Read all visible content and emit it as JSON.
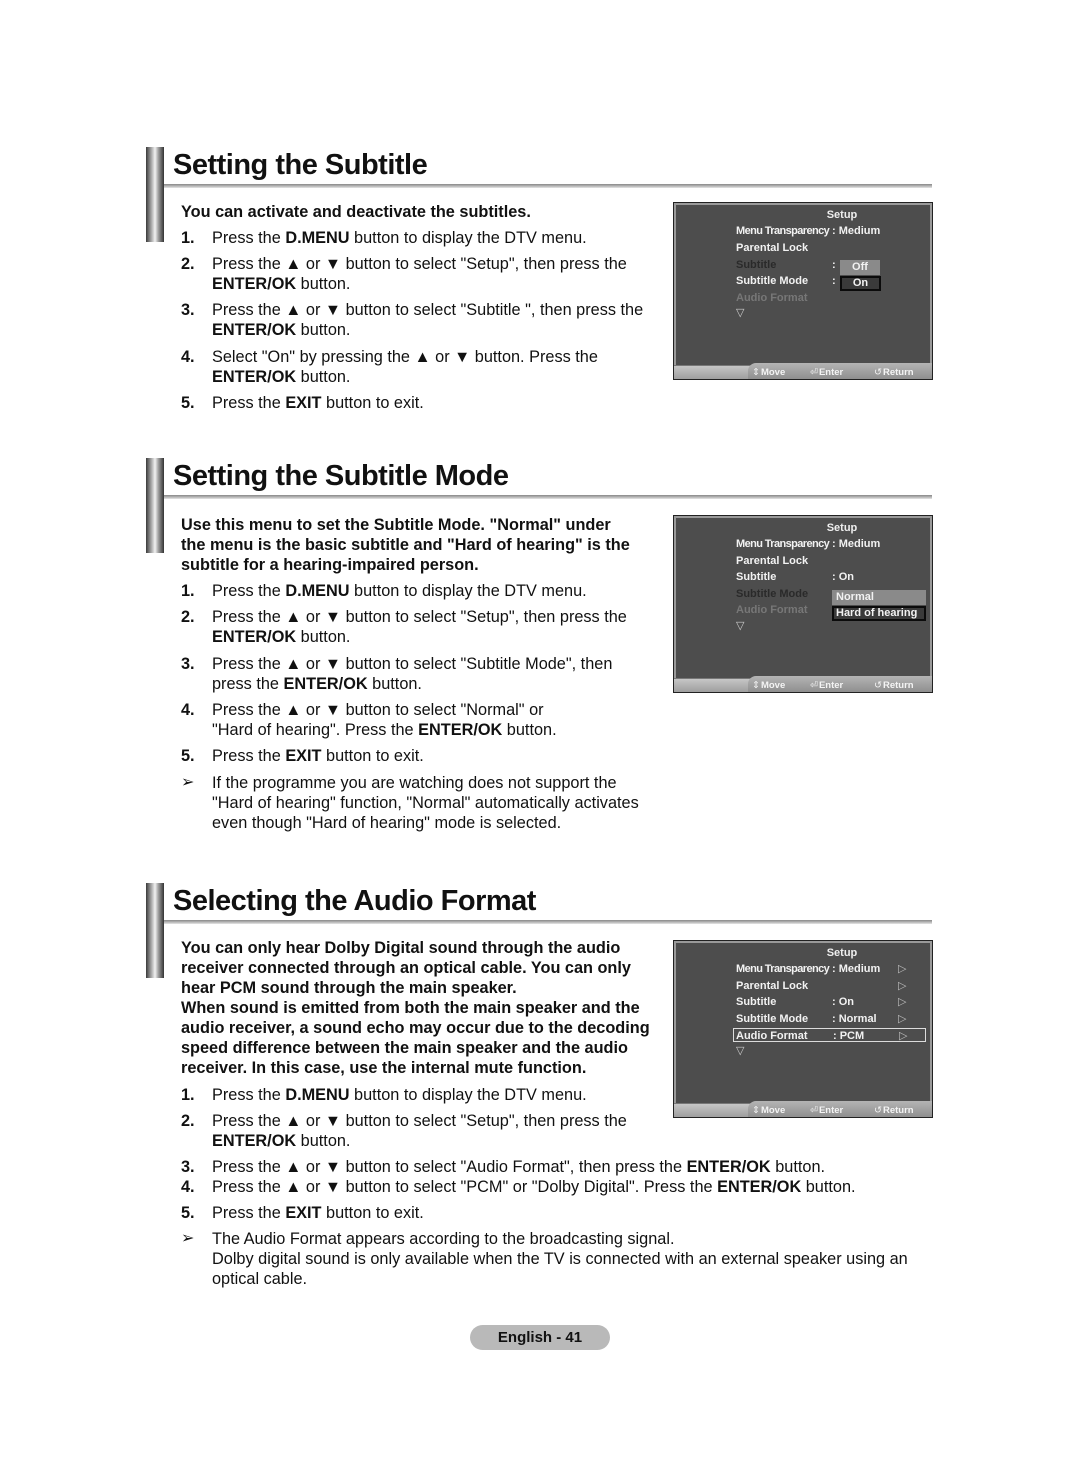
{
  "sections": [
    {
      "title": "Setting the Subtitle",
      "intro": [
        "You can activate and deactivate the subtitles."
      ],
      "steps": [
        {
          "num": "1.",
          "lines": [
            [
              "Press the ",
              "",
              "D.MENU",
              " button to display the DTV menu."
            ]
          ]
        },
        {
          "num": "2.",
          "lines": [
            [
              "Press the ▲ or ▼ button to select \"Setup\", then press the"
            ],
            [
              "",
              "",
              "ENTER/OK",
              " button."
            ]
          ]
        },
        {
          "num": "3.",
          "lines": [
            [
              "Press the ▲ or ▼ button to select \"Subtitle \", then press the"
            ],
            [
              "",
              "",
              "ENTER/OK",
              " button."
            ]
          ]
        },
        {
          "num": "4.",
          "lines": [
            [
              "Select \"On\" by pressing the ▲ or ▼ button. Press the"
            ],
            [
              "",
              "",
              "ENTER/OK",
              " button."
            ]
          ]
        },
        {
          "num": "5.",
          "lines": [
            [
              "Press the ",
              "",
              "EXIT",
              " button to exit."
            ]
          ]
        }
      ],
      "osd": {
        "header": "Setup",
        "rows": [
          {
            "label": "Menu Transparency",
            "value": ": Medium"
          },
          {
            "label": "Parental Lock",
            "value": ""
          },
          {
            "label": "Subtitle",
            "value": ":"
          },
          {
            "label": "Subtitle  Mode",
            "value": ":"
          },
          {
            "label": "Audio Format",
            "value": ""
          }
        ],
        "options": [
          "Off",
          "On"
        ],
        "more": "▽"
      }
    },
    {
      "title": "Setting the Subtitle Mode",
      "intro": [
        "Use this menu to set the Subtitle Mode. \"Normal\" under",
        "the menu is the basic subtitle and \"Hard of hearing\" is the",
        "subtitle for a hearing-impaired person."
      ],
      "steps": [
        {
          "num": "1.",
          "lines": [
            [
              "Press the ",
              "",
              "D.MENU",
              " button to display the DTV menu."
            ]
          ]
        },
        {
          "num": "2.",
          "lines": [
            [
              "Press the ▲ or ▼ button to select \"Setup\", then press the"
            ],
            [
              "",
              "",
              "ENTER/OK",
              " button."
            ]
          ]
        },
        {
          "num": "3.",
          "lines": [
            [
              "Press the ▲ or ▼ button to select \"Subtitle  Mode\", then"
            ],
            [
              "press the ",
              "",
              "ENTER/OK",
              " button."
            ]
          ]
        },
        {
          "num": "4.",
          "lines": [
            [
              "Press the ▲ or ▼ button to select \"Normal\" or"
            ],
            [
              "\"Hard of hearing\". Press the ",
              "",
              "ENTER/OK",
              " button."
            ]
          ]
        },
        {
          "num": "5.",
          "lines": [
            [
              "Press the ",
              "",
              "EXIT",
              " button to exit."
            ]
          ]
        }
      ],
      "note": {
        "symbol": "➢",
        "lines": [
          "If the programme you are watching does not support the",
          "\"Hard of hearing\" function, \"Normal\" automatically activates",
          "even though \"Hard of hearing\" mode is selected."
        ]
      },
      "osd": {
        "header": "Setup",
        "rows": [
          {
            "label": "Menu Transparency",
            "value": ": Medium"
          },
          {
            "label": "Parental Lock",
            "value": ""
          },
          {
            "label": "Subtitle",
            "value": ": On"
          },
          {
            "label": "Subtitle  Mode",
            "value": ""
          },
          {
            "label": "Audio Format",
            "value": ""
          }
        ],
        "options": [
          "Normal",
          "Hard of hearing"
        ],
        "more": "▽"
      }
    },
    {
      "title": "Selecting the Audio Format",
      "intro": [
        "You can only hear Dolby Digital sound through the audio",
        "receiver connected through an optical cable. You can only",
        "hear PCM sound through the main speaker.",
        "When sound is emitted from both the main speaker and the",
        "audio receiver, a sound echo may occur due to the decoding",
        "speed difference between the main speaker and the audio",
        "receiver. In this case, use the internal mute function."
      ],
      "steps": [
        {
          "num": "1.",
          "lines": [
            [
              "Press the ",
              "",
              "D.MENU",
              " button to display the DTV menu."
            ]
          ]
        },
        {
          "num": "2.",
          "lines": [
            [
              "Press the ▲ or ▼ button to select \"Setup\", then press the"
            ],
            [
              "",
              "",
              "ENTER/OK",
              " button."
            ]
          ]
        },
        {
          "num": "3.",
          "lines": [
            [
              "Press the ▲ or ▼ button to select \"Audio Format\", then press the ",
              "",
              "ENTER/OK",
              " button."
            ]
          ]
        },
        {
          "num": "4.",
          "lines": [
            [
              "Press the ▲ or ▼ button to select \"PCM\" or \"Dolby Digital\". Press the ",
              "",
              "ENTER/OK",
              " button."
            ]
          ]
        },
        {
          "num": "5.",
          "lines": [
            [
              "Press the ",
              "",
              "EXIT",
              " button to exit."
            ]
          ]
        }
      ],
      "note": {
        "symbol": "➢",
        "lines": [
          "The Audio Format appears according to the broadcasting signal.",
          "Dolby digital sound is only available when the TV is connected with an external speaker using an",
          "optical cable."
        ]
      },
      "osd": {
        "header": "Setup",
        "rows": [
          {
            "label": "Menu Transparency",
            "value": ": Medium",
            "arrow": "▷"
          },
          {
            "label": "Parental Lock",
            "value": "",
            "arrow": "▷"
          },
          {
            "label": "Subtitle",
            "value": ": On",
            "arrow": "▷"
          },
          {
            "label": "Subtitle  Mode",
            "value": ": Normal",
            "arrow": "▷"
          },
          {
            "label": "Audio Format",
            "value": ": PCM",
            "arrow": "▷"
          }
        ],
        "more": "▽"
      }
    }
  ],
  "osd_footer": {
    "move_icon": "⇕",
    "move": "Move",
    "enter_icon": "⏎",
    "enter": "Enter",
    "return_icon": "↺",
    "return": "Return"
  },
  "page_label": "English - 41",
  "colors": {
    "osd_background": "#4d4d4d",
    "osd_highlight": "#8a8a8a",
    "page_pill": "#b9b9b9"
  }
}
